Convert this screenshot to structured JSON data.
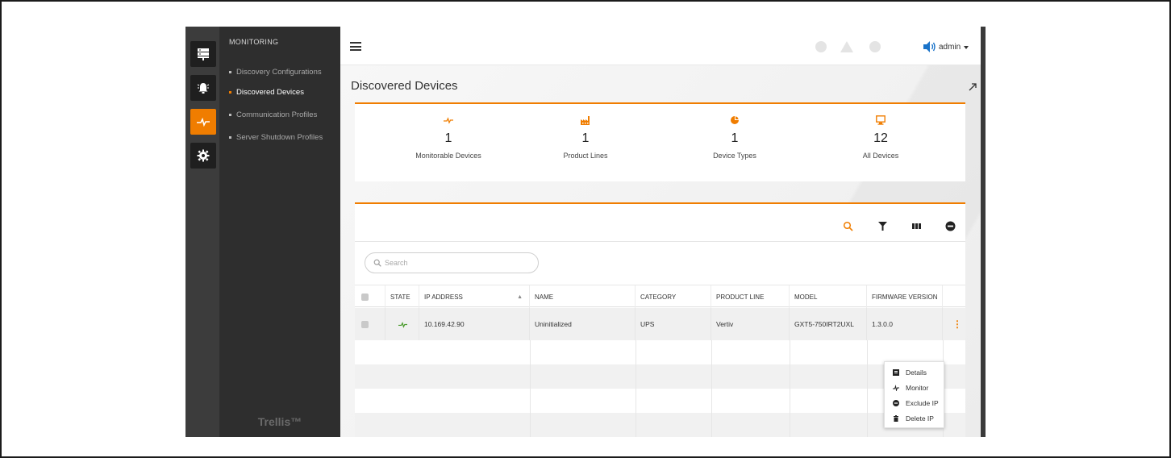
{
  "nav": {
    "section_title": "MONITORING",
    "items": [
      {
        "label": "Discovery Configurations",
        "active": false
      },
      {
        "label": "Discovered Devices",
        "active": true
      },
      {
        "label": "Communication Profiles",
        "active": false
      },
      {
        "label": "Server Shutdown Profiles",
        "active": false
      }
    ],
    "brand": "Trellis™"
  },
  "rail": {
    "icons": [
      "server-icon",
      "alarm-bell-icon",
      "monitoring-pulse-icon",
      "settings-gear-icon"
    ],
    "active_index": 2
  },
  "topbar": {
    "user": "admin"
  },
  "page": {
    "title": "Discovered Devices"
  },
  "summary": [
    {
      "icon": "pulse-icon",
      "value": "1",
      "label": "Monitorable Devices"
    },
    {
      "icon": "factory-icon",
      "value": "1",
      "label": "Product Lines"
    },
    {
      "icon": "pie-chart-icon",
      "value": "1",
      "label": "Device Types"
    },
    {
      "icon": "monitor-icon",
      "value": "12",
      "label": "All Devices"
    }
  ],
  "table": {
    "search_placeholder": "Search",
    "columns": [
      "",
      "STATE",
      "IP ADDRESS",
      "NAME",
      "CATEGORY",
      "PRODUCT LINE",
      "MODEL",
      "FIRMWARE VERSION",
      ""
    ],
    "rows": [
      {
        "state": "pulse",
        "ip": "10.169.42.90",
        "name": "Uninitialized",
        "category": "UPS",
        "product_line": "Vertiv",
        "model": "GXT5-750IRT2UXL",
        "firmware": "1.3.0.0"
      }
    ]
  },
  "context_menu": {
    "items": [
      {
        "icon": "details-icon",
        "label": "Details"
      },
      {
        "icon": "monitor-pulse-icon",
        "label": "Monitor"
      },
      {
        "icon": "exclude-icon",
        "label": "Exclude IP"
      },
      {
        "icon": "trash-icon",
        "label": "Delete IP"
      }
    ]
  },
  "colors": {
    "accent": "#f07d00",
    "state_ok": "#4a9a2c",
    "sidebar": "#2e2e2e",
    "rail": "#3c3c3c"
  }
}
